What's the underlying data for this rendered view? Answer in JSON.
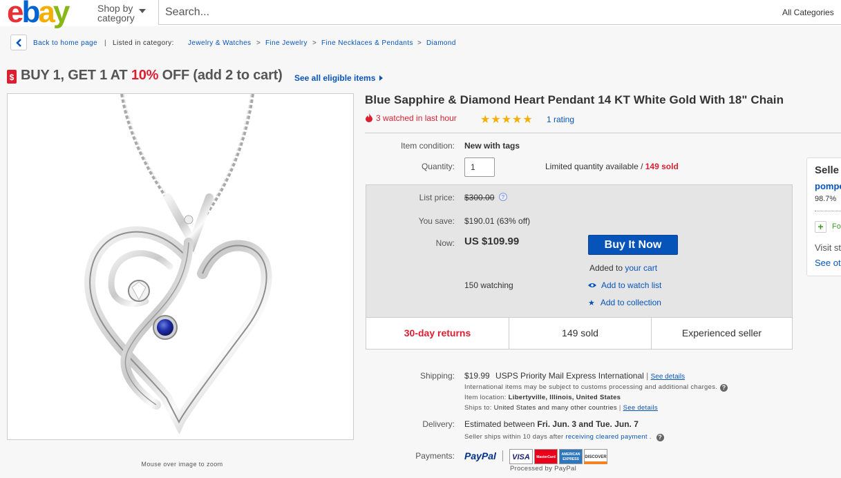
{
  "header": {
    "logo": {
      "letters": [
        "e",
        "b",
        "a",
        "y"
      ],
      "colors": [
        "#e53238",
        "#0064d2",
        "#f5af02",
        "#86b817"
      ]
    },
    "shop_by": "Shop by",
    "category": "category",
    "search_placeholder": "Search...",
    "all_categories": "All Categories"
  },
  "breadcrumb": {
    "back": "Back to home page",
    "separator": "|",
    "listed_in": "Listed in category:",
    "items": [
      "Jewelry & Watches",
      "Fine Jewelry",
      "Fine Necklaces & Pendants",
      "Diamond"
    ],
    "arrow": ">"
  },
  "promo": {
    "icon": "$",
    "part1": "BUY 1, GET 1 AT ",
    "highlight": "10%",
    "part2": " OFF (add 2 to cart)",
    "see_all": "See all eligible items",
    "accent": "#dd1e31"
  },
  "gallery": {
    "zoom_hint": "Mouse over image to zoom"
  },
  "item": {
    "title": "Blue Sapphire & Diamond Heart Pendant 14 KT White Gold With 18\" Chain",
    "watched": "3 watched in last hour",
    "stars": "★★★★★",
    "rating": "1 rating",
    "condition_label": "Item condition:",
    "condition": "New with tags",
    "quantity_label": "Quantity:",
    "quantity": "1",
    "availability": "Limited quantity available / ",
    "sold_count": "149 sold"
  },
  "price": {
    "list_label": "List price:",
    "list": "$300.00",
    "save_label": "You save:",
    "save": "$190.01 (63% off)",
    "now_label": "Now:",
    "now": "US $109.99",
    "buy_now": "Buy It Now",
    "added_to": "Added to ",
    "your_cart": "your cart",
    "watching": "150 watching",
    "watch_list": "Add to watch list",
    "collection": "Add to collection"
  },
  "highlights": [
    "30-day returns",
    "149 sold",
    "Experienced seller"
  ],
  "shipping": {
    "label": "Shipping:",
    "cost": "$19.99",
    "service": "USPS Priority Mail Express International",
    "pipe": "|",
    "see_details": "See details",
    "note": "International items may be subject to customs processing and additional charges.",
    "location_label": "Item location:",
    "location": "Libertyville, Illinois, United States",
    "ships_label": "Ships to:",
    "ships_to": "United States and many other countries",
    "see_details2": "See details"
  },
  "delivery": {
    "label": "Delivery:",
    "text": "Estimated between ",
    "dates": "Fri. Jun. 3 and Tue. Jun. 7",
    "note": "Seller ships within 10 days after ",
    "note_link": "receiving cleared payment",
    "dot": "."
  },
  "payments": {
    "label": "Payments:",
    "paypal": "PayPal",
    "cards": [
      "VISA",
      "MasterCard",
      "AMERICAN EXPRESS",
      "DISCOVER"
    ],
    "processed": "Processed by PayPal"
  },
  "seller": {
    "title": "Selle",
    "name": "pompe",
    "feedback": "98.7%",
    "follow": "Fo",
    "visit": "Visit st",
    "see_other": "See ot"
  }
}
